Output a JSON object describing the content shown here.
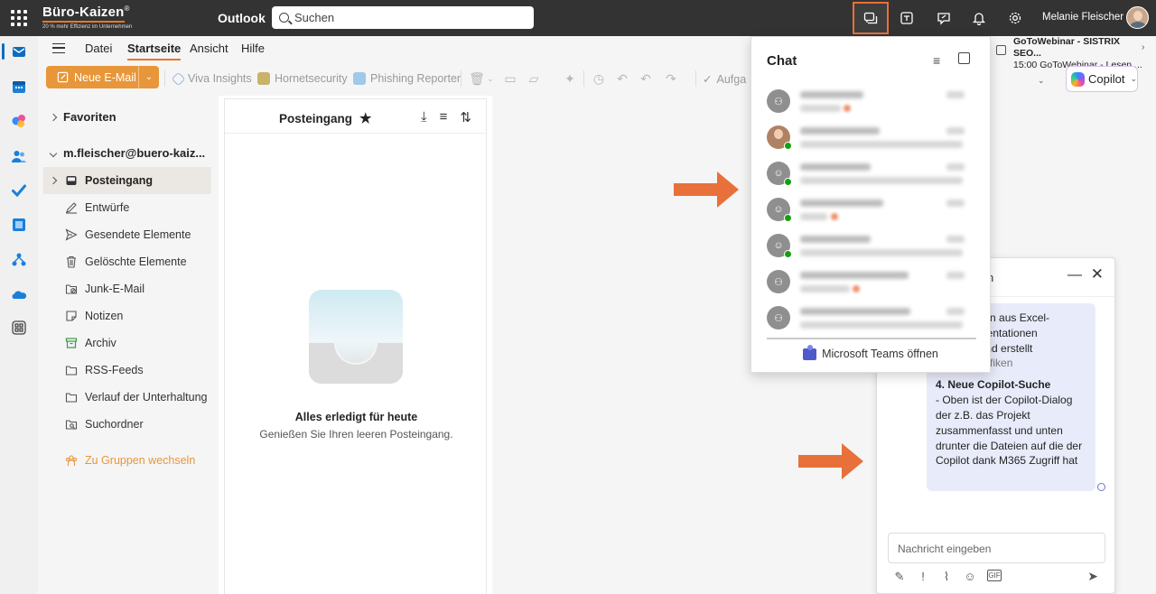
{
  "topbar": {
    "brand": "Büro-Kaizen",
    "brand_reg": "®",
    "brand_tagline": "20 % mehr Effizienz im Unternehmen",
    "app_name": "Outlook",
    "search_placeholder": "Suchen",
    "user_name": "Melanie Fleischer"
  },
  "ribbon": {
    "tabs": [
      "Datei",
      "Startseite",
      "Ansicht",
      "Hilfe"
    ],
    "selected_tab": "Startseite",
    "new_mail": "Neue E-Mail",
    "addins": [
      "Viva Insights",
      "Hornetsecurity",
      "Phishing Reporter"
    ],
    "truncated": "Aufga",
    "copilot": "Copilot"
  },
  "webinar": {
    "title": "GoToWebinar - SISTRIX SEO...",
    "detail": "15:00 GoToWebinar - Lesen ..."
  },
  "folders": {
    "favorites": "Favoriten",
    "account": "m.fleischer@buero-kaiz...",
    "items": [
      {
        "label": "Posteingang",
        "icon": "inbox-icon",
        "selected": true
      },
      {
        "label": "Entwürfe",
        "icon": "pencil-icon"
      },
      {
        "label": "Gesendete Elemente",
        "icon": "send-icon"
      },
      {
        "label": "Gelöschte Elemente",
        "icon": "trash-icon"
      },
      {
        "label": "Junk-E-Mail",
        "icon": "junk-icon"
      },
      {
        "label": "Notizen",
        "icon": "note-icon"
      },
      {
        "label": "Archiv",
        "icon": "archive-icon"
      },
      {
        "label": "RSS-Feeds",
        "icon": "folder-icon"
      },
      {
        "label": "Verlauf der Unterhaltung",
        "icon": "folder-icon"
      },
      {
        "label": "Suchordner",
        "icon": "search-folder-icon"
      }
    ],
    "switch_groups": "Zu Gruppen wechseln"
  },
  "message_list": {
    "title": "Posteingang",
    "empty_title": "Alles erledigt für heute",
    "empty_subtitle": "Genießen Sie Ihren leeren Posteingang."
  },
  "chat": {
    "title": "Chat",
    "open_teams": "Microsoft Teams öffnen",
    "rows": [
      {
        "avatar": "group"
      },
      {
        "avatar": "photo",
        "presence": "available"
      },
      {
        "avatar": "person",
        "presence": "available"
      },
      {
        "avatar": "person",
        "presence": "available"
      },
      {
        "avatar": "person",
        "presence": "available"
      },
      {
        "avatar": "group"
      },
      {
        "avatar": "group"
      }
    ]
  },
  "teams_window": {
    "title": "n",
    "bubble_lines": [
      "zt Daten aus Excel-",
      "Präsentationen",
      "en und erstellt",
      "daraus Grafiken"
    ],
    "bubble_heading": "4. Neue Copilot-Suche",
    "bubble_body": "- Oben ist der Copilot-Dialog der z.B. das Projekt zusammenfasst und unten drunter die Dateien auf die der Copilot dank M365 Zugriff hat",
    "input_placeholder": "Nachricht eingeben"
  },
  "colors": {
    "topbar": "#333333",
    "accent_orange": "#e87722",
    "new_mail_button": "#e8963a",
    "arrow": "#e8703a",
    "outlook_blue": "#0f6cbd",
    "bubble": "#e8ebfa"
  }
}
